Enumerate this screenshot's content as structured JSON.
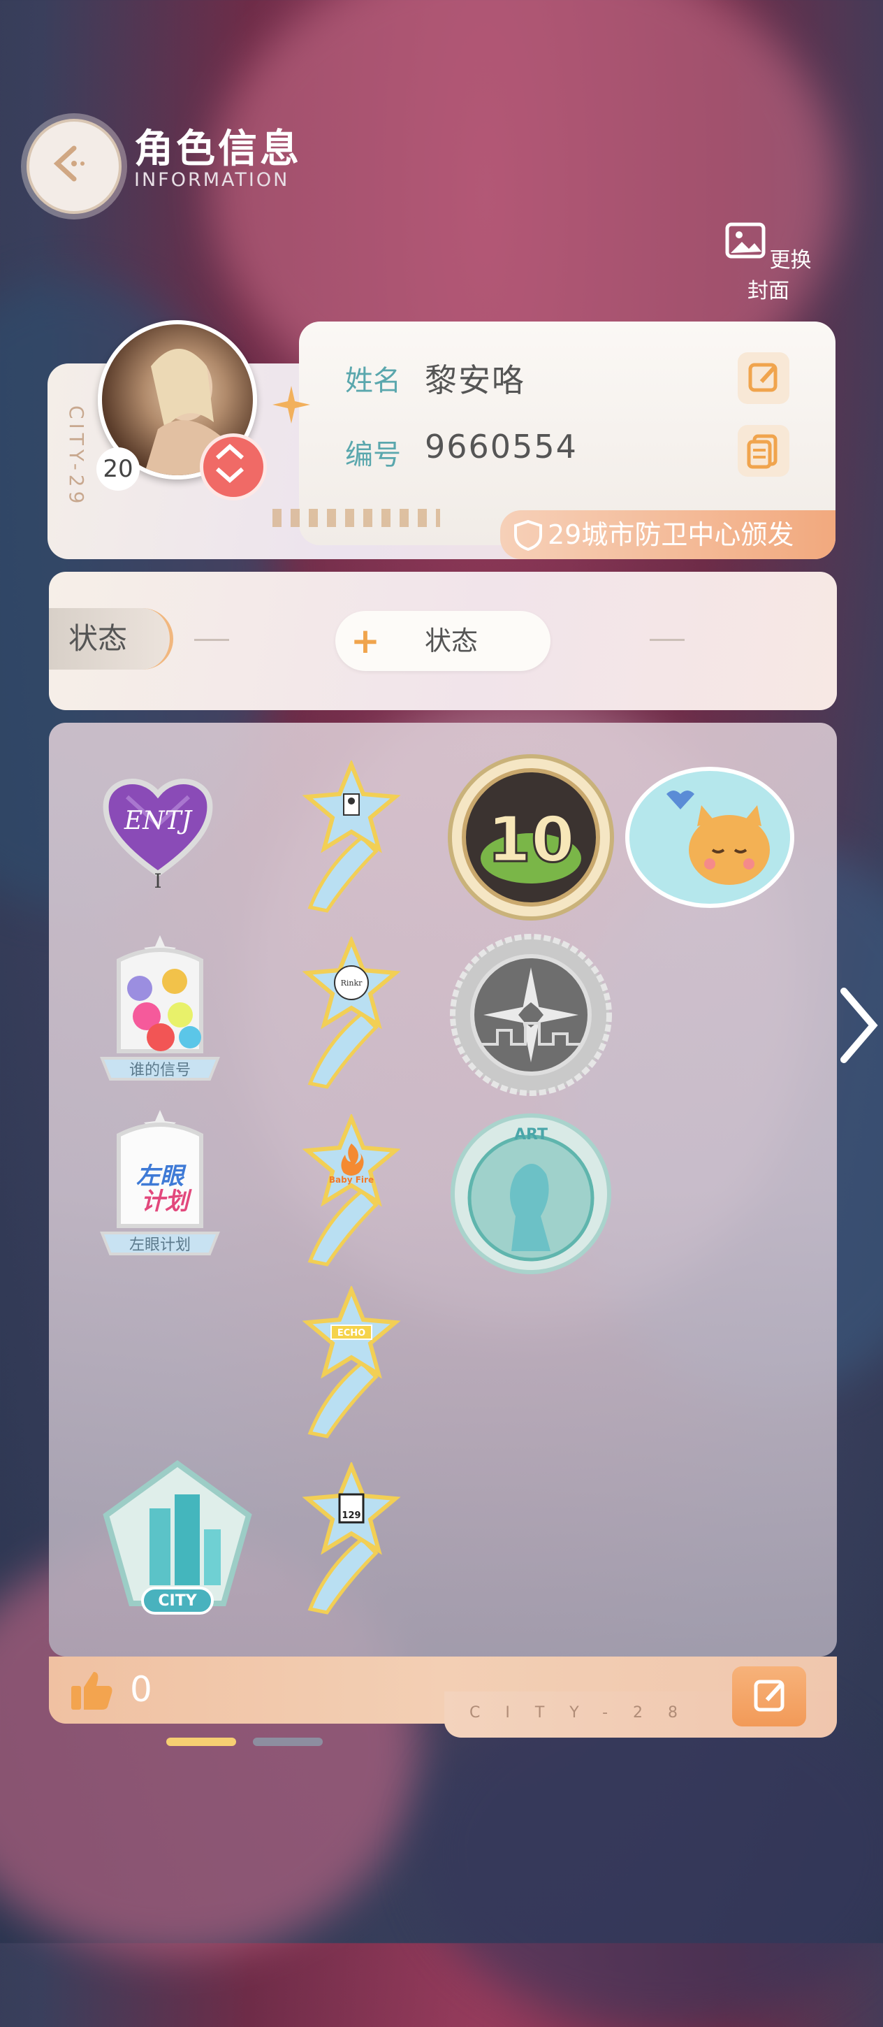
{
  "header": {
    "title": "角色信息",
    "subtitle": "INFORMATION",
    "back_icon": "back-chevron-icon"
  },
  "cover": {
    "label": "更换封面",
    "icon": "image-icon"
  },
  "profile": {
    "city_tag": "CITY-29",
    "level": "20",
    "name_label": "姓名",
    "name_value": "黎安咯",
    "id_label": "编号",
    "id_value": "9660554",
    "issuer": "29城市防卫中心颁发"
  },
  "status": {
    "tab_label": "状态",
    "add_label": "状态",
    "add_icon": "plus-icon"
  },
  "badges": [
    {
      "name": "enfj-heart-badge",
      "text": "ENTJ"
    },
    {
      "name": "star-wand-badge-1"
    },
    {
      "name": "ten-coin-badge",
      "text": "10"
    },
    {
      "name": "cat-sticker-badge"
    },
    {
      "name": "mystery-balls-badge",
      "text": "谁的信号"
    },
    {
      "name": "star-wand-badge-2",
      "text": "Rinkr"
    },
    {
      "name": "compass-city-badge"
    },
    {
      "name": "left-eye-plan-badge",
      "text": "左眼计划"
    },
    {
      "name": "star-wand-badge-3",
      "text": "Baby Fire"
    },
    {
      "name": "art-statue-badge",
      "text": "ART"
    },
    {
      "name": "star-wand-badge-4",
      "text": "ECHO"
    },
    {
      "name": "city-building-badge",
      "text": "CITY"
    },
    {
      "name": "star-wand-badge-5",
      "text": "129"
    }
  ],
  "footer": {
    "like_count": "0",
    "city_mark": "CITY-28"
  },
  "colors": {
    "accent": "#f29a58",
    "teal": "#5aa7ad",
    "issuer": "#f2a97e"
  }
}
